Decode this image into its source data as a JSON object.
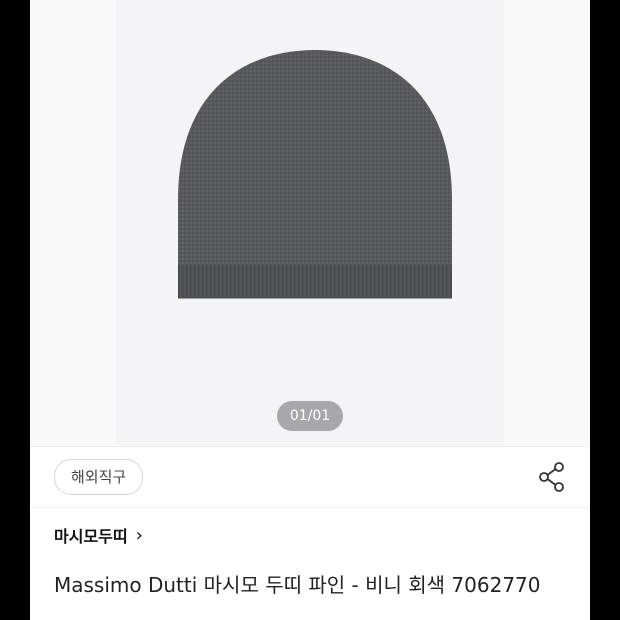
{
  "gallery": {
    "counter": "01/01",
    "image_alt": "gray knit beanie"
  },
  "badge": {
    "label": "해외직구"
  },
  "share": {
    "icon": "share-icon"
  },
  "brand": {
    "name": "마시모두띠",
    "chevron": "›"
  },
  "product": {
    "title": "Massimo Dutti 마시모 두띠 파인 - 비니 회색 7062770"
  },
  "colors": {
    "hat": "#58595b",
    "hero_bg": "#f4f4f6",
    "counter_bg": "#a8a8ab"
  }
}
